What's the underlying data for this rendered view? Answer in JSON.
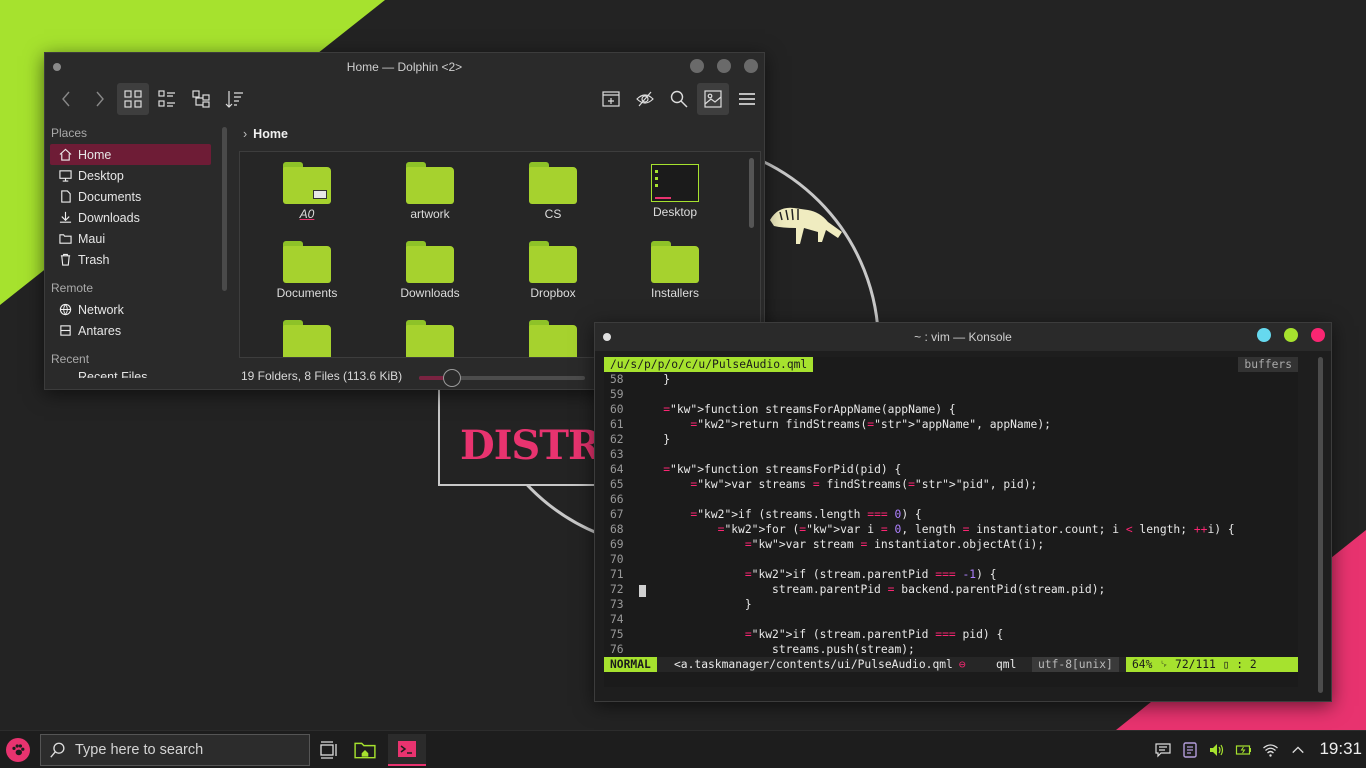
{
  "dolphin": {
    "title": "Home — Dolphin <2>",
    "breadcrumb": "Home",
    "places_header": "Places",
    "places": [
      "Home",
      "Desktop",
      "Documents",
      "Downloads",
      "Maui",
      "Trash"
    ],
    "remote_header": "Remote",
    "remote": [
      "Network",
      "Antares"
    ],
    "recent_header": "Recent",
    "recent": [
      "Recent Files"
    ],
    "files": [
      "A0",
      "artwork",
      "CS",
      "Desktop",
      "Documents",
      "Downloads",
      "Dropbox",
      "Installers",
      "",
      "",
      ""
    ],
    "status": "19 Folders, 8 Files (113.6 KiB)",
    "zoom_fraction": 0.2
  },
  "konsole": {
    "title": "~ : vim — Konsole",
    "buffer_name": "/u/s/p/p/o/c/u/PulseAudio.qml",
    "buffers_label": "buffers",
    "lines": [
      {
        "n": "58",
        "t": "    }"
      },
      {
        "n": "59",
        "t": ""
      },
      {
        "n": "60",
        "t": "    function streamsForAppName(appName) {"
      },
      {
        "n": "61",
        "t": "        return findStreams(\"appName\", appName);"
      },
      {
        "n": "62",
        "t": "    }"
      },
      {
        "n": "63",
        "t": ""
      },
      {
        "n": "64",
        "t": "    function streamsForPid(pid) {"
      },
      {
        "n": "65",
        "t": "        var streams = findStreams(\"pid\", pid);"
      },
      {
        "n": "66",
        "t": ""
      },
      {
        "n": "67",
        "t": "        if (streams.length === 0) {"
      },
      {
        "n": "68",
        "t": "            for (var i = 0, length = instantiator.count; i < length; ++i) {"
      },
      {
        "n": "69",
        "t": "                var stream = instantiator.objectAt(i);"
      },
      {
        "n": "70",
        "t": ""
      },
      {
        "n": "71",
        "t": "                if (stream.parentPid === -1) {"
      },
      {
        "n": "72",
        "t": "                    stream.parentPid = backend.parentPid(stream.pid);"
      },
      {
        "n": "73",
        "t": "                }"
      },
      {
        "n": "74",
        "t": ""
      },
      {
        "n": "75",
        "t": "                if (stream.parentPid === pid) {"
      },
      {
        "n": "76",
        "t": "                    streams.push(stream);"
      }
    ],
    "status": {
      "mode": "NORMAL",
      "path": "<a.taskmanager/contents/ui/PulseAudio.qml",
      "err": "⊖",
      "filetype": "qml",
      "encoding": "utf-8[unix]",
      "position": "64%  ␊  72/111  ▯  :  2"
    }
  },
  "taskbar": {
    "search_placeholder": "Type here to search",
    "clock": "19:31"
  },
  "colors": {
    "accent_green": "#a6e22e",
    "accent_pink": "#e8336f",
    "selection": "#6e1c36"
  }
}
